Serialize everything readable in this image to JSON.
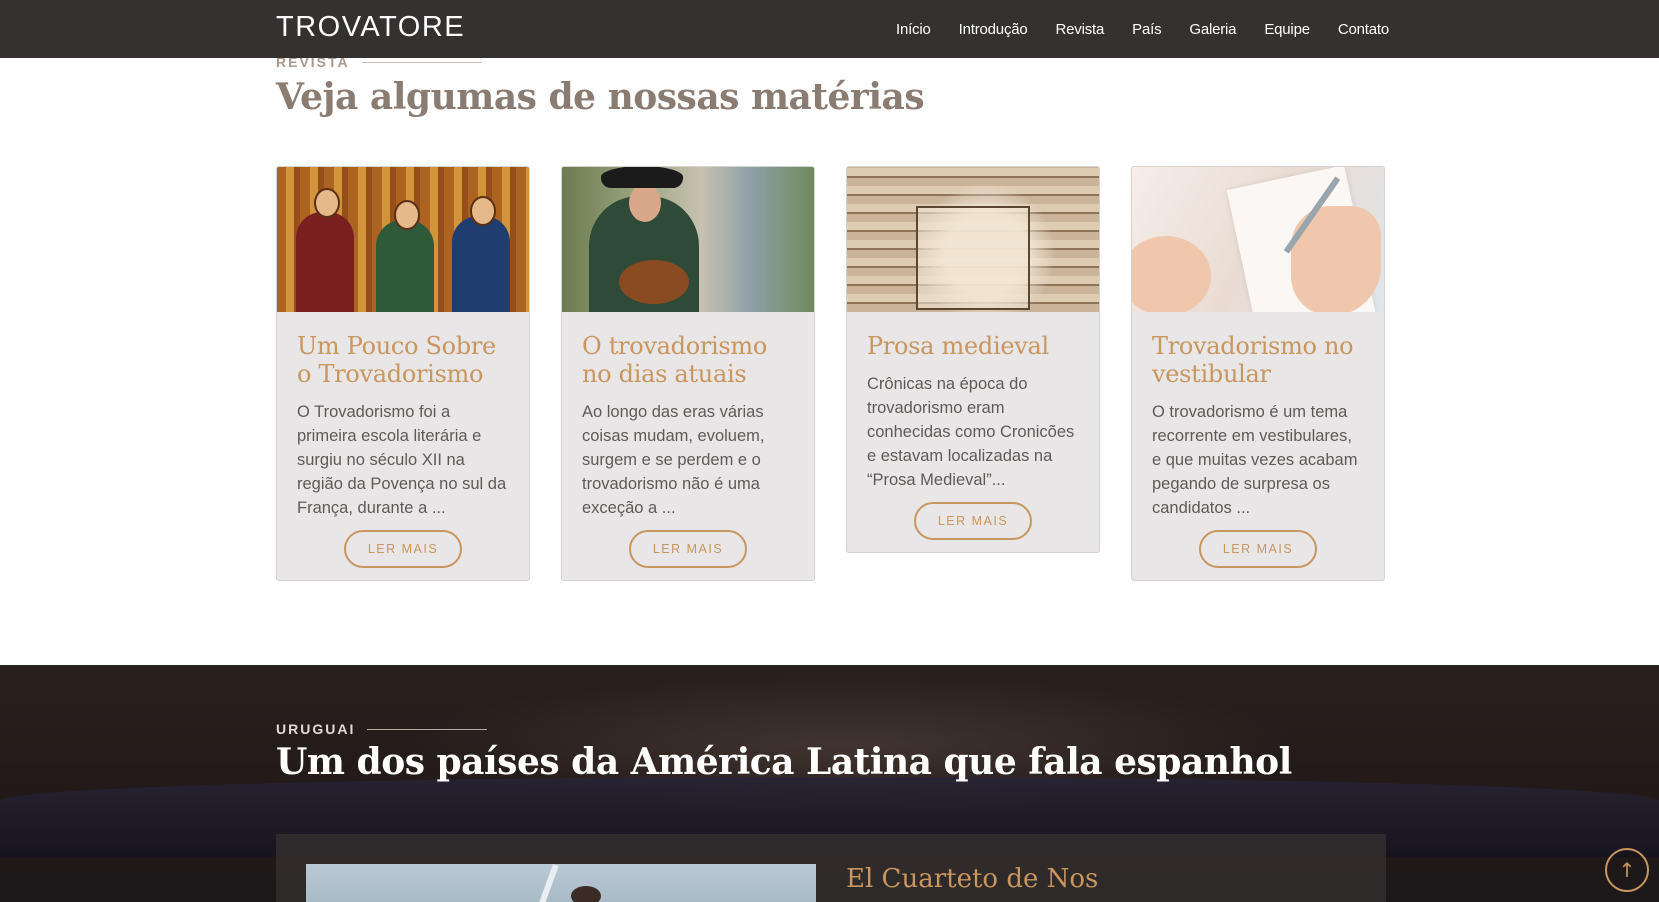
{
  "navbar": {
    "brand": "TROVATORE",
    "links": [
      "Início",
      "Introdução",
      "Revista",
      "País",
      "Galeria",
      "Equipe",
      "Contato"
    ]
  },
  "revista": {
    "eyebrow": "REVISTA",
    "title": "Veja algumas de nossas matérias",
    "cards": [
      {
        "title": "Um Pouco Sobre o Trovadorismo",
        "text": "O Trovadorismo foi a primeira escola literária e surgiu no século XII na região da Povença no sul da França, durante a ...",
        "button": "LER MAIS",
        "image": "medieval-troubadours-illustration"
      },
      {
        "title": "O trovadorismo no dias atuais",
        "text": "Ao longo das eras várias coisas mudam, evoluem, surgem e se perdem e o trovadorismo não é uma exceção a ...",
        "button": "LER MAIS",
        "image": "street-musician-photo"
      },
      {
        "title": "Prosa medieval",
        "text": "Crônicas na época do trovadorismo eram conhecidas como Cronicões e estavam localizadas na “Prosa Medieval”...",
        "button": "LER MAIS",
        "image": "medieval-scribe-engraving"
      },
      {
        "title": "Trovadorismo no vestibular",
        "text": "O trovadorismo é um tema recorrente em vestibulares, e que muitas vezes acabam pegando de surpresa os candidatos ...",
        "button": "LER MAIS",
        "image": "hand-writing-photo"
      }
    ]
  },
  "uruguai": {
    "eyebrow": "URUGUAI",
    "title": "Um dos países da América Latina que fala espanhol",
    "feature_title": "El Cuarteto de Nos"
  },
  "scroll_top": {
    "icon": "arrow-up-icon",
    "glyph": "↑"
  },
  "colors": {
    "accent": "#c8965e",
    "nav_bg": "#353130",
    "card_bg": "#e8e6e6",
    "title_muted": "#8b7c73"
  }
}
